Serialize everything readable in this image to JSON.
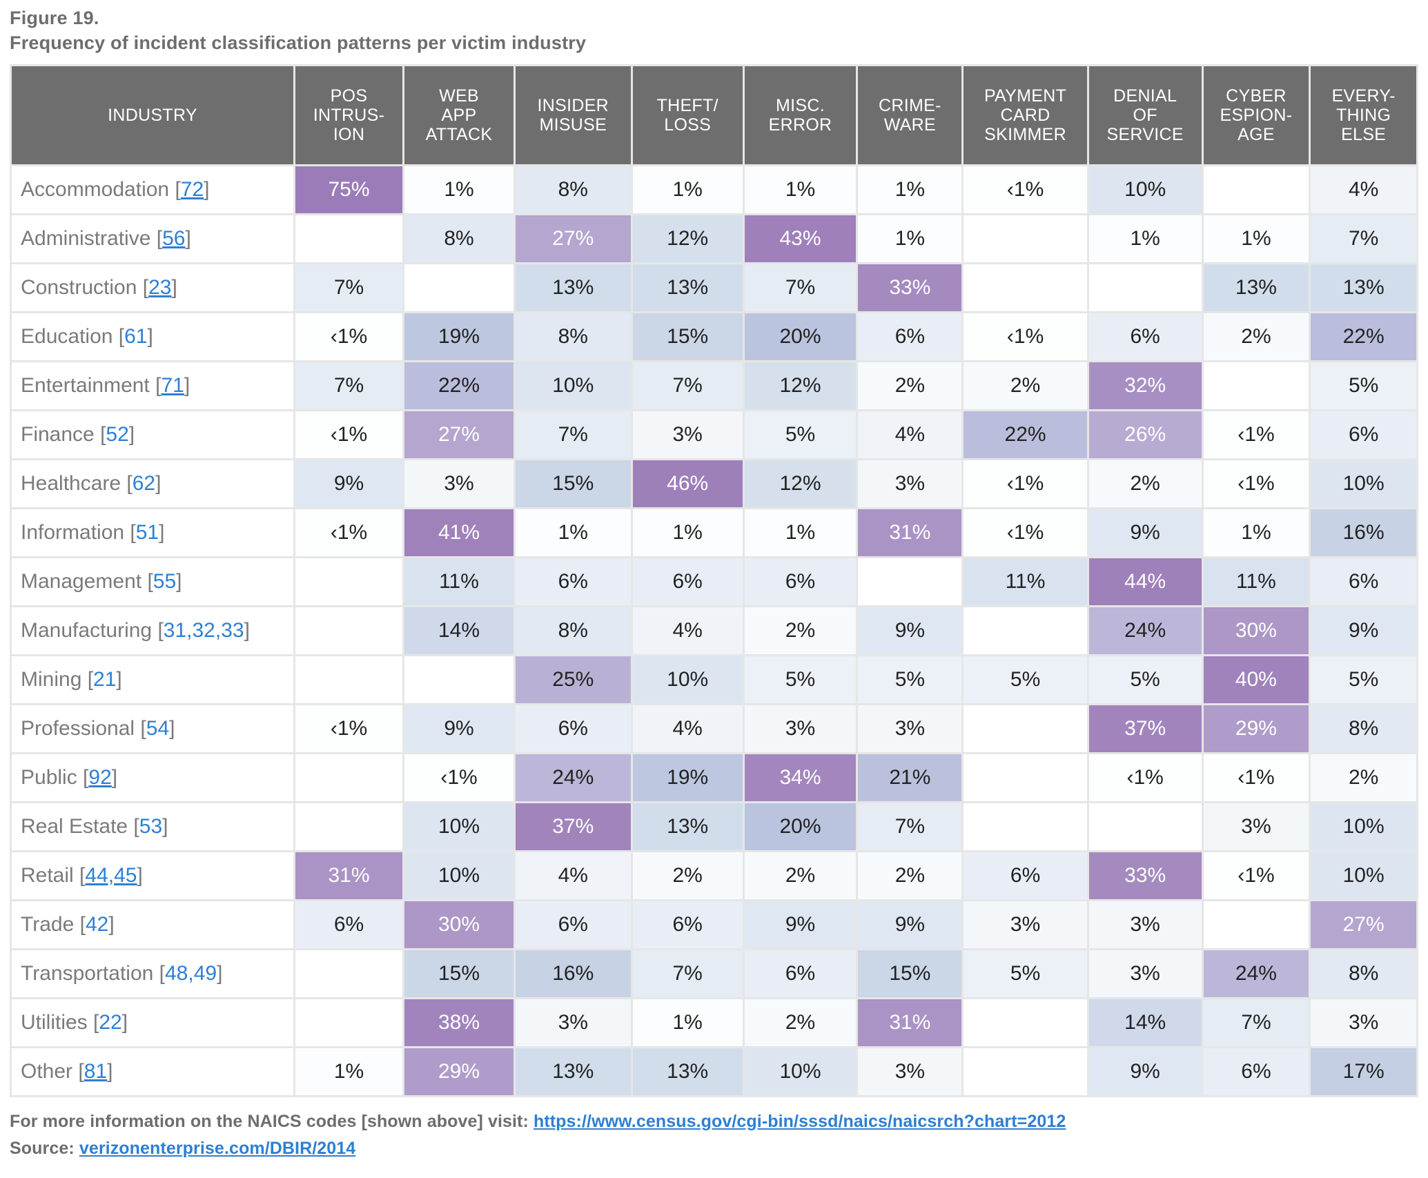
{
  "figure": {
    "label": "Figure 19.",
    "title": "Frequency of incident classification patterns per victim industry"
  },
  "colors": {
    "header_bg": "#6e6e6e",
    "header_text": "#ffffff",
    "grid": "#e6e6e6",
    "link": "#2d7fd3",
    "title_text": "#6d6d6d",
    "industry_text": "#7a7a7a",
    "scale_high": "#9f83b9",
    "scale_mid": "#b7aed4",
    "scale_low": "#c9d5e5",
    "scale_lowest": "#ffffff"
  },
  "table": {
    "columns": [
      "INDUSTRY",
      "POS INTRUS-ION",
      "WEB APP ATTACK",
      "INSIDER MISUSE",
      "THEFT/ LOSS",
      "MISC. ERROR",
      "CRIME-WARE",
      "PAYMENT CARD SKIMMER",
      "DENIAL OF SERVICE",
      "CYBER ESPION-AGE",
      "EVERY-THING ELSE"
    ],
    "column_lines": [
      [
        "INDUSTRY"
      ],
      [
        "POS",
        "INTRUS-",
        "ION"
      ],
      [
        "WEB",
        "APP",
        "ATTACK"
      ],
      [
        "INSIDER",
        "MISUSE"
      ],
      [
        "THEFT/",
        "LOSS"
      ],
      [
        "MISC.",
        "ERROR"
      ],
      [
        "CRIME-",
        "WARE"
      ],
      [
        "PAYMENT",
        "CARD",
        "SKIMMER"
      ],
      [
        "DENIAL",
        "OF",
        "SERVICE"
      ],
      [
        "CYBER",
        "ESPION-",
        "AGE"
      ],
      [
        "EVERY-",
        "THING",
        "ELSE"
      ]
    ],
    "rows": [
      {
        "industry": "Accommodation",
        "codes": [
          {
            "text": "72",
            "link": true
          }
        ],
        "values": [
          "75%",
          "1%",
          "8%",
          "1%",
          "1%",
          "1%",
          "‹1%",
          "10%",
          "",
          "4%"
        ]
      },
      {
        "industry": "Administrative",
        "codes": [
          {
            "text": "56",
            "link": true
          }
        ],
        "values": [
          "",
          "8%",
          "27%",
          "12%",
          "43%",
          "1%",
          "",
          "1%",
          "1%",
          "7%"
        ]
      },
      {
        "industry": "Construction",
        "codes": [
          {
            "text": "23",
            "link": true
          }
        ],
        "values": [
          "7%",
          "",
          "13%",
          "13%",
          "7%",
          "33%",
          "",
          "",
          "13%",
          "13%"
        ]
      },
      {
        "industry": "Education",
        "codes": [
          {
            "text": "61",
            "link": false
          }
        ],
        "values": [
          "‹1%",
          "19%",
          "8%",
          "15%",
          "20%",
          "6%",
          "‹1%",
          "6%",
          "2%",
          "22%"
        ]
      },
      {
        "industry": "Entertainment",
        "codes": [
          {
            "text": "71",
            "link": true
          }
        ],
        "values": [
          "7%",
          "22%",
          "10%",
          "7%",
          "12%",
          "2%",
          "2%",
          "32%",
          "",
          "5%"
        ]
      },
      {
        "industry": "Finance",
        "codes": [
          {
            "text": "52",
            "link": false
          }
        ],
        "values": [
          "‹1%",
          "27%",
          "7%",
          "3%",
          "5%",
          "4%",
          "22%",
          "26%",
          "‹1%",
          "6%"
        ]
      },
      {
        "industry": "Healthcare",
        "codes": [
          {
            "text": "62",
            "link": false
          }
        ],
        "values": [
          "9%",
          "3%",
          "15%",
          "46%",
          "12%",
          "3%",
          "‹1%",
          "2%",
          "‹1%",
          "10%"
        ]
      },
      {
        "industry": "Information",
        "codes": [
          {
            "text": "51",
            "link": false
          }
        ],
        "values": [
          "‹1%",
          "41%",
          "1%",
          "1%",
          "1%",
          "31%",
          "‹1%",
          "9%",
          "1%",
          "16%"
        ]
      },
      {
        "industry": "Management",
        "codes": [
          {
            "text": "55",
            "link": false
          }
        ],
        "values": [
          "",
          "11%",
          "6%",
          "6%",
          "6%",
          "",
          "11%",
          "44%",
          "11%",
          "6%"
        ]
      },
      {
        "industry": "Manufacturing",
        "codes": [
          {
            "text": "31,32,33",
            "link": false
          }
        ],
        "values": [
          "",
          "14%",
          "8%",
          "4%",
          "2%",
          "9%",
          "",
          "24%",
          "30%",
          "9%"
        ]
      },
      {
        "industry": "Mining",
        "codes": [
          {
            "text": "21",
            "link": false
          }
        ],
        "values": [
          "",
          "",
          "25%",
          "10%",
          "5%",
          "5%",
          "5%",
          "5%",
          "40%",
          "5%"
        ]
      },
      {
        "industry": "Professional",
        "codes": [
          {
            "text": "54",
            "link": false
          }
        ],
        "values": [
          "‹1%",
          "9%",
          "6%",
          "4%",
          "3%",
          "3%",
          "",
          "37%",
          "29%",
          "8%"
        ]
      },
      {
        "industry": "Public",
        "codes": [
          {
            "text": "92",
            "link": true
          }
        ],
        "values": [
          "",
          "‹1%",
          "24%",
          "19%",
          "34%",
          "21%",
          "",
          "‹1%",
          "‹1%",
          "2%"
        ]
      },
      {
        "industry": "Real Estate",
        "codes": [
          {
            "text": "53",
            "link": false
          }
        ],
        "values": [
          "",
          "10%",
          "37%",
          "13%",
          "20%",
          "7%",
          "",
          "",
          "3%",
          "10%"
        ]
      },
      {
        "industry": "Retail",
        "codes": [
          {
            "text": "44,45",
            "link": true
          }
        ],
        "values": [
          "31%",
          "10%",
          "4%",
          "2%",
          "2%",
          "2%",
          "6%",
          "33%",
          "‹1%",
          "10%"
        ]
      },
      {
        "industry": "Trade",
        "codes": [
          {
            "text": "42",
            "link": false
          }
        ],
        "values": [
          "6%",
          "30%",
          "6%",
          "6%",
          "9%",
          "9%",
          "3%",
          "3%",
          "",
          "27%"
        ]
      },
      {
        "industry": "Transportation",
        "codes": [
          {
            "text": "48,49",
            "link": false
          }
        ],
        "values": [
          "",
          "15%",
          "16%",
          "7%",
          "6%",
          "15%",
          "5%",
          "3%",
          "24%",
          "8%"
        ]
      },
      {
        "industry": "Utilities",
        "codes": [
          {
            "text": "22",
            "link": false
          }
        ],
        "values": [
          "",
          "38%",
          "3%",
          "1%",
          "2%",
          "31%",
          "",
          "14%",
          "7%",
          "3%"
        ]
      },
      {
        "industry": "Other",
        "codes": [
          {
            "text": "81",
            "link": true
          }
        ],
        "values": [
          "1%",
          "29%",
          "13%",
          "13%",
          "10%",
          "3%",
          "",
          "9%",
          "6%",
          "17%"
        ]
      }
    ]
  },
  "footer": {
    "naics_prefix": "For more information on the NAICS codes [shown above] visit:",
    "naics_url": "https://www.census.gov/cgi-bin/sssd/naics/naicsrch?chart=2012",
    "source_label": "Source:",
    "source_url": "verizonenterprise.com/DBIR/2014"
  }
}
